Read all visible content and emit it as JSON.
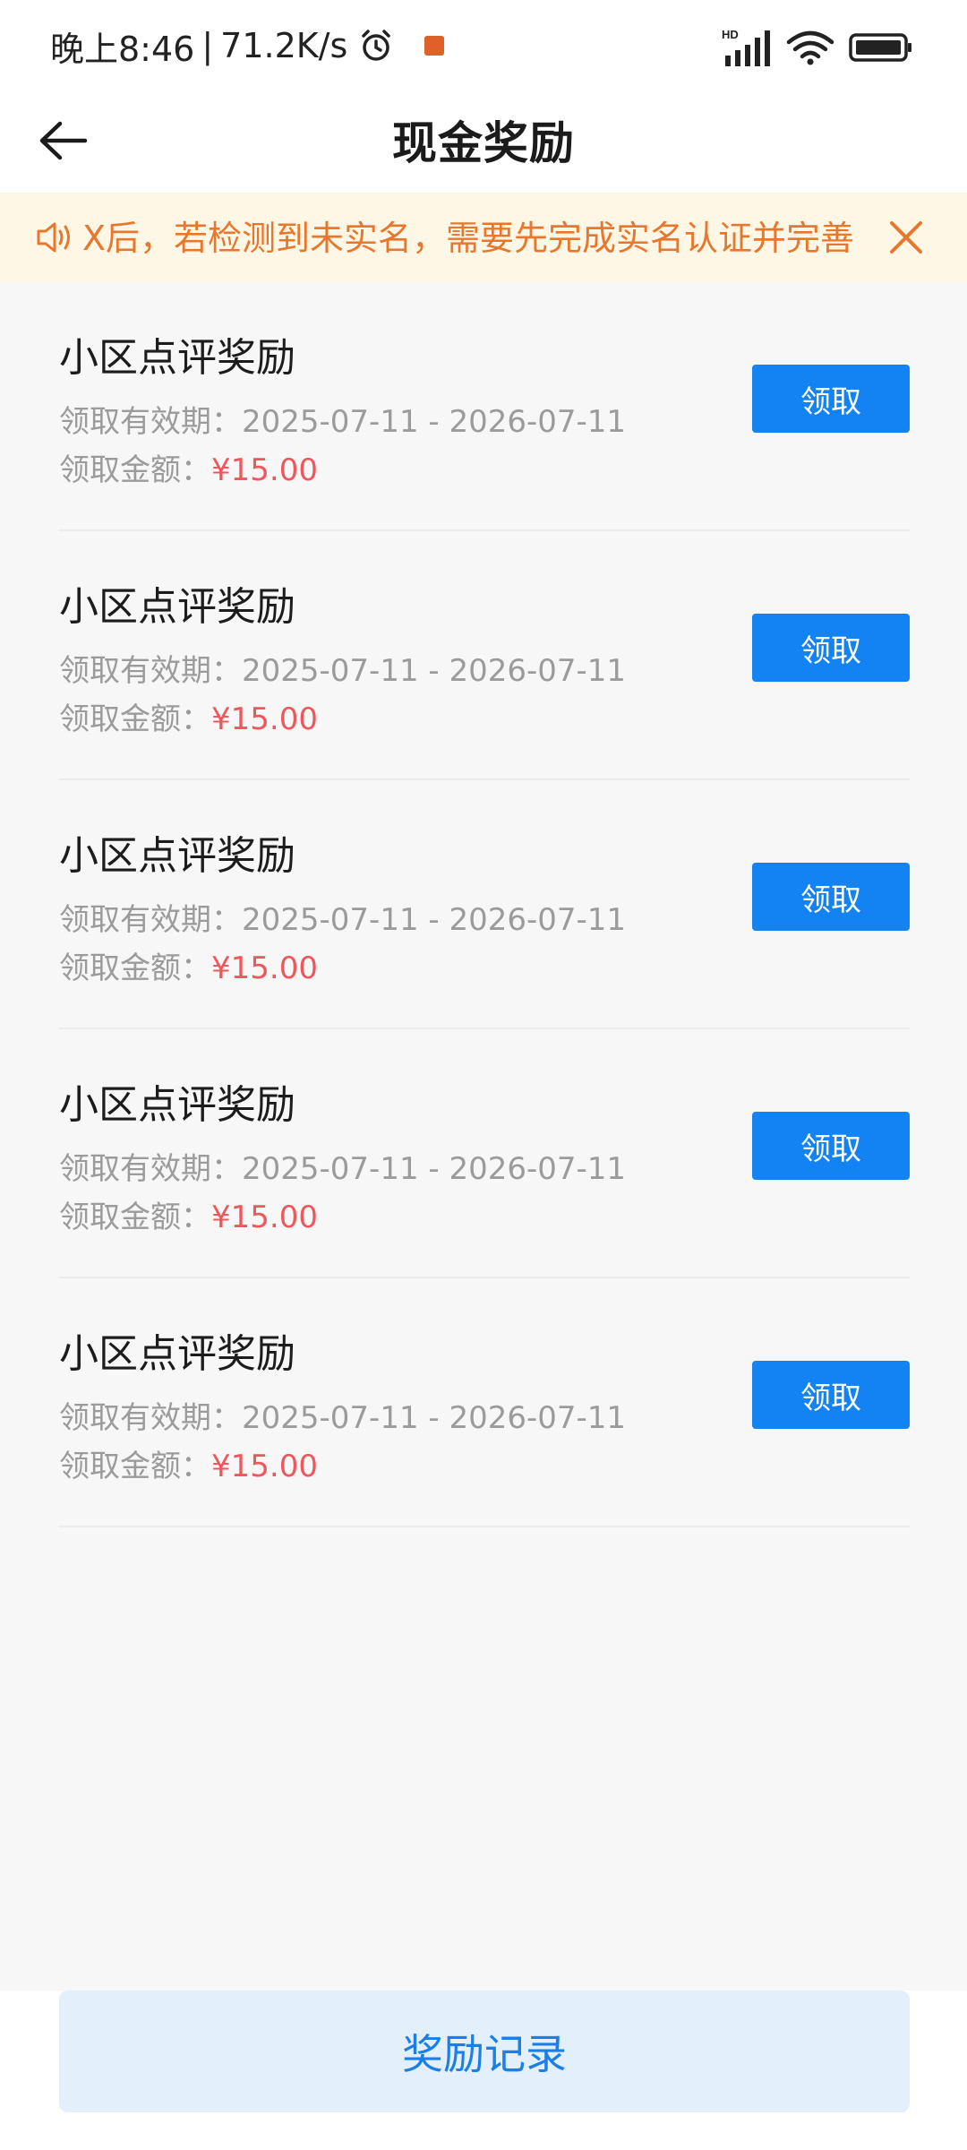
{
  "status_bar": {
    "time": "晚上8:46",
    "separator": "|",
    "speed": "71.2K/s",
    "network": "HD",
    "icons": [
      "alarm-icon",
      "app-notification-icon",
      "signal-icon",
      "wifi-icon",
      "battery-icon"
    ]
  },
  "header": {
    "title": "现金奖励",
    "back_icon": "back-arrow-icon"
  },
  "notice": {
    "text": "X后，若检测到未实名，需要先完成实名认证并完善",
    "icon": "speaker-icon",
    "close_icon": "close-icon"
  },
  "rewards": [
    {
      "title": "小区点评奖励",
      "period_label": "领取有效期：",
      "period": "2025-07-11 - 2026-07-11",
      "amount_label": "领取金额：",
      "amount": "¥15.00",
      "button": "领取"
    },
    {
      "title": "小区点评奖励",
      "period_label": "领取有效期：",
      "period": "2025-07-11 - 2026-07-11",
      "amount_label": "领取金额：",
      "amount": "¥15.00",
      "button": "领取"
    },
    {
      "title": "小区点评奖励",
      "period_label": "领取有效期：",
      "period": "2025-07-11 - 2026-07-11",
      "amount_label": "领取金额：",
      "amount": "¥15.00",
      "button": "领取"
    },
    {
      "title": "小区点评奖励",
      "period_label": "领取有效期：",
      "period": "2025-07-11 - 2026-07-11",
      "amount_label": "领取金额：",
      "amount": "¥15.00",
      "button": "领取"
    },
    {
      "title": "小区点评奖励",
      "period_label": "领取有效期：",
      "period": "2025-07-11 - 2026-07-11",
      "amount_label": "领取金额：",
      "amount": "¥15.00",
      "button": "领取"
    }
  ],
  "footer": {
    "record_button": "奖励记录"
  },
  "colors": {
    "primary": "#1383f4",
    "amount": "#f0575a",
    "notice_text": "#e8772e",
    "notice_bg": "#fff7e6"
  }
}
